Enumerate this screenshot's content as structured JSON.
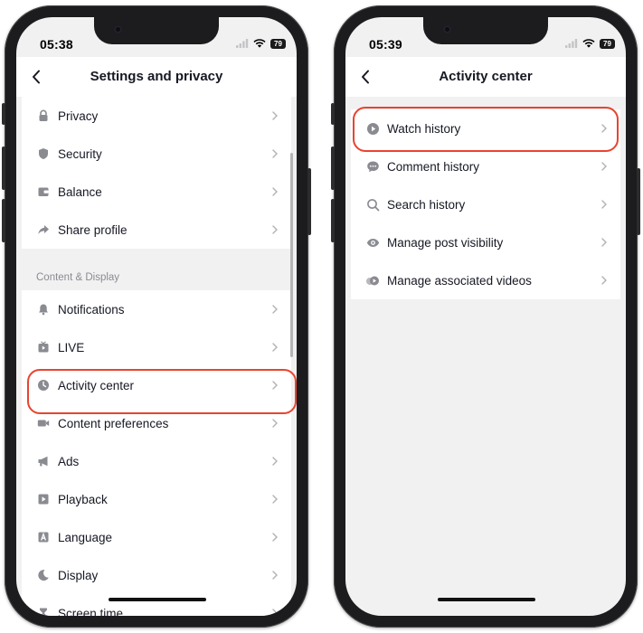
{
  "colors": {
    "highlight": "#e8442f",
    "background": "#f1f1f2",
    "card": "#ffffff",
    "text": "#161823",
    "icon": "#8a8b91"
  },
  "left_screen": {
    "status_time": "05:38",
    "battery": "79",
    "title": "Settings and privacy",
    "group1": [
      {
        "label": "Privacy",
        "icon": "lock-icon"
      },
      {
        "label": "Security",
        "icon": "shield-icon"
      },
      {
        "label": "Balance",
        "icon": "wallet-icon"
      },
      {
        "label": "Share profile",
        "icon": "share-icon"
      }
    ],
    "section_header": "Content & Display",
    "group2": [
      {
        "label": "Notifications",
        "icon": "bell-icon"
      },
      {
        "label": "LIVE",
        "icon": "live-icon"
      },
      {
        "label": "Activity center",
        "icon": "clock-icon",
        "highlighted": true
      },
      {
        "label": "Content preferences",
        "icon": "video-camera-icon"
      },
      {
        "label": "Ads",
        "icon": "megaphone-icon"
      },
      {
        "label": "Playback",
        "icon": "play-icon"
      },
      {
        "label": "Language",
        "icon": "language-icon"
      },
      {
        "label": "Display",
        "icon": "moon-icon"
      },
      {
        "label": "Screen time",
        "icon": "hourglass-icon"
      }
    ]
  },
  "right_screen": {
    "status_time": "05:39",
    "battery": "79",
    "title": "Activity center",
    "items": [
      {
        "label": "Watch history",
        "icon": "play-circle-icon",
        "highlighted": true
      },
      {
        "label": "Comment history",
        "icon": "comment-icon"
      },
      {
        "label": "Search history",
        "icon": "search-icon"
      },
      {
        "label": "Manage post visibility",
        "icon": "eye-icon"
      },
      {
        "label": "Manage associated videos",
        "icon": "associated-videos-icon"
      }
    ]
  }
}
